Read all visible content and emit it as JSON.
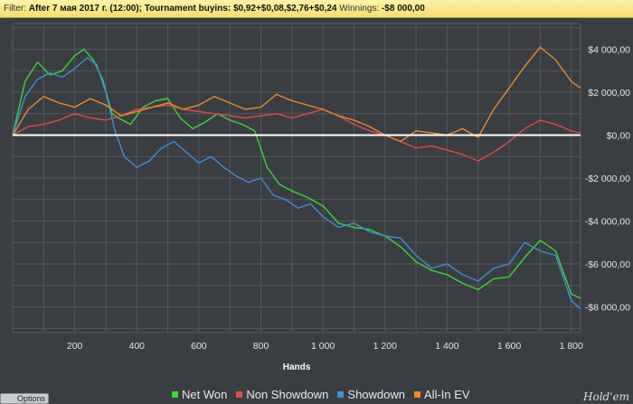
{
  "filter": {
    "filter_label": "Filter:",
    "filter_value": "After 7 мая 2017 г. (12:00);",
    "buyins_label": "Tournament buyins:",
    "buyins_value": "$0,92+$0,08,$2,76+$0,24",
    "winnings_label": "Winnings:",
    "winnings_value": "-$8 000,00"
  },
  "options_label": "Options",
  "brand_label": "Hold'em",
  "colors": {
    "background": "#3a3d42",
    "grid": "#55595f",
    "zero_line": "#ffffff",
    "net_won": "#3ed43a",
    "non_showdown": "#e04b4b",
    "showdown": "#3f8fd6",
    "all_in_ev": "#ee8a2a"
  },
  "chart_data": {
    "type": "line",
    "xlabel": "Hands",
    "ylabel": "",
    "xlim": [
      0,
      1830
    ],
    "ylim": [
      -9200,
      5200
    ],
    "x_ticks": [
      200,
      400,
      600,
      800,
      1000,
      1200,
      1400,
      1600,
      1800
    ],
    "x_tick_labels": [
      "200",
      "400",
      "600",
      "800",
      "1 000",
      "1 200",
      "1 400",
      "1 600",
      "1 800"
    ],
    "y_ticks": [
      4000,
      2000,
      0,
      -2000,
      -4000,
      -6000,
      -8000
    ],
    "y_tick_labels": [
      "$4 000,00",
      "$2 000,00",
      "$0,00",
      "-$2 000,00",
      "-$4 000,00",
      "-$6 000,00",
      "-$8 000,00"
    ],
    "grid": true,
    "legend_position": "bottom",
    "series": [
      {
        "name": "Net Won",
        "color": "#3ed43a",
        "x": [
          0,
          40,
          80,
          120,
          160,
          200,
          230,
          260,
          290,
          320,
          340,
          380,
          420,
          460,
          500,
          540,
          580,
          620,
          660,
          700,
          740,
          780,
          820,
          860,
          900,
          950,
          1000,
          1050,
          1100,
          1150,
          1200,
          1250,
          1300,
          1350,
          1400,
          1450,
          1500,
          1550,
          1600,
          1650,
          1700,
          1750,
          1800,
          1830
        ],
        "y": [
          0,
          2500,
          3400,
          2800,
          3000,
          3700,
          4000,
          3500,
          2600,
          1000,
          800,
          500,
          1300,
          1600,
          1700,
          800,
          300,
          600,
          1000,
          700,
          500,
          200,
          -1500,
          -2300,
          -2600,
          -2900,
          -3300,
          -4100,
          -4300,
          -4400,
          -4700,
          -5200,
          -5900,
          -6300,
          -6500,
          -6900,
          -7200,
          -6700,
          -6600,
          -5700,
          -4900,
          -5400,
          -7400,
          -7600
        ]
      },
      {
        "name": "Non Showdown",
        "color": "#e04b4b",
        "x": [
          0,
          50,
          100,
          150,
          200,
          250,
          300,
          350,
          400,
          450,
          500,
          550,
          600,
          650,
          700,
          750,
          800,
          850,
          900,
          950,
          1000,
          1050,
          1100,
          1150,
          1200,
          1250,
          1300,
          1350,
          1400,
          1450,
          1500,
          1550,
          1600,
          1650,
          1700,
          1750,
          1800,
          1830
        ],
        "y": [
          0,
          400,
          500,
          700,
          1000,
          800,
          700,
          900,
          1200,
          1300,
          1400,
          1200,
          1100,
          1000,
          900,
          800,
          900,
          1000,
          800,
          1000,
          1200,
          900,
          500,
          200,
          0,
          -300,
          -600,
          -500,
          -700,
          -900,
          -1200,
          -800,
          -300,
          300,
          700,
          500,
          200,
          100
        ]
      },
      {
        "name": "Showdown",
        "color": "#3f8fd6",
        "x": [
          0,
          40,
          80,
          120,
          160,
          200,
          240,
          270,
          300,
          330,
          360,
          400,
          440,
          480,
          520,
          560,
          600,
          640,
          680,
          720,
          760,
          800,
          840,
          880,
          920,
          960,
          1000,
          1050,
          1100,
          1150,
          1200,
          1250,
          1300,
          1350,
          1400,
          1450,
          1500,
          1550,
          1600,
          1650,
          1700,
          1750,
          1800,
          1830
        ],
        "y": [
          0,
          1800,
          2600,
          2900,
          2700,
          3100,
          3600,
          3300,
          2000,
          200,
          -1000,
          -1500,
          -1200,
          -600,
          -300,
          -800,
          -1300,
          -1000,
          -1500,
          -1900,
          -2200,
          -2000,
          -2800,
          -3000,
          -3400,
          -3200,
          -3800,
          -4300,
          -4100,
          -4500,
          -4700,
          -4800,
          -5600,
          -6200,
          -6000,
          -6500,
          -6800,
          -6200,
          -6000,
          -5000,
          -5400,
          -5600,
          -7700,
          -8100
        ]
      },
      {
        "name": "All-In EV",
        "color": "#ee8a2a",
        "x": [
          0,
          50,
          100,
          150,
          200,
          250,
          300,
          350,
          400,
          450,
          500,
          550,
          600,
          650,
          700,
          750,
          800,
          850,
          900,
          950,
          1000,
          1050,
          1100,
          1150,
          1200,
          1250,
          1300,
          1350,
          1400,
          1450,
          1500,
          1550,
          1600,
          1650,
          1700,
          1750,
          1800,
          1830
        ],
        "y": [
          0,
          1200,
          1800,
          1500,
          1300,
          1700,
          1400,
          900,
          1100,
          1300,
          1500,
          1200,
          1400,
          1800,
          1500,
          1200,
          1300,
          1900,
          1600,
          1400,
          1200,
          900,
          700,
          400,
          0,
          -300,
          200,
          100,
          0,
          300,
          -100,
          1200,
          2200,
          3200,
          4100,
          3500,
          2500,
          2200
        ]
      }
    ]
  }
}
